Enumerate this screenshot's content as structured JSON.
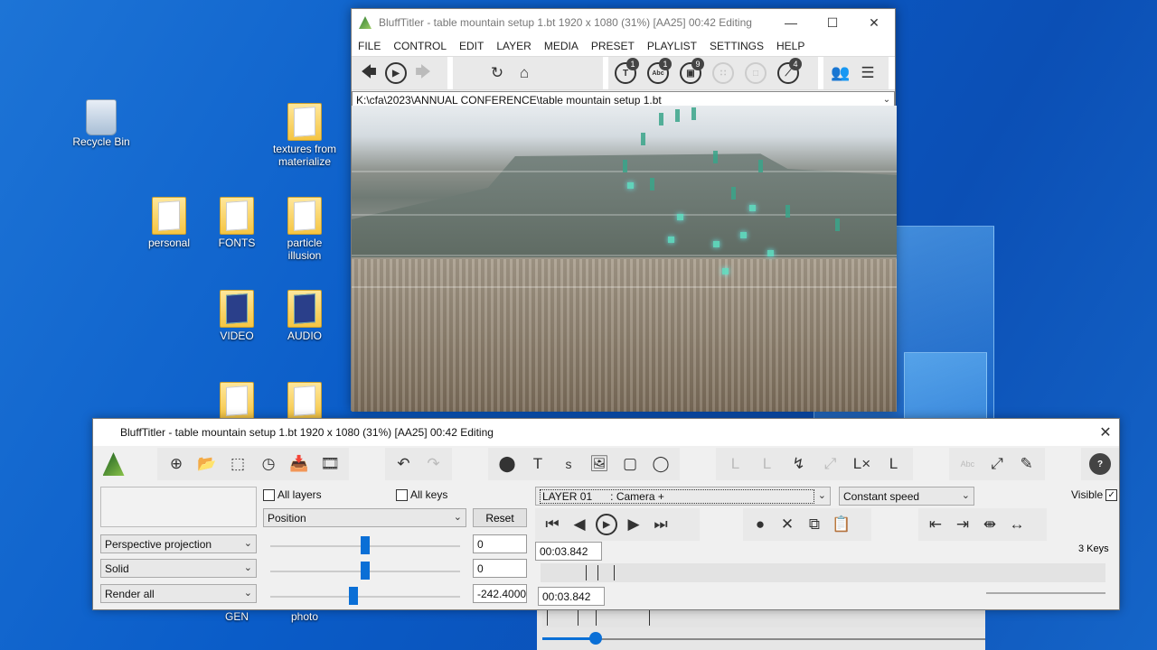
{
  "desktop": {
    "icons": [
      {
        "label": "Recycle Bin",
        "kind": "bin"
      },
      {
        "label": "textures from materialize",
        "kind": "folder"
      },
      {
        "label": "personal",
        "kind": "folder"
      },
      {
        "label": "FONTS",
        "kind": "folder"
      },
      {
        "label": "particle illusion",
        "kind": "folder"
      },
      {
        "label": "VIDEO",
        "kind": "folder-dark"
      },
      {
        "label": "AUDIO",
        "kind": "folder-dark"
      },
      {
        "label": "GEN",
        "kind": "folder"
      },
      {
        "label": "photo",
        "kind": "folder"
      }
    ]
  },
  "main_window": {
    "title": "BluffTitler - table mountain setup 1.bt 1920 x 1080 (31%) [AA25] 00:42 Editing",
    "menu": [
      "FILE",
      "CONTROL",
      "EDIT",
      "LAYER",
      "MEDIA",
      "PRESET",
      "PLAYLIST",
      "SETTINGS",
      "HELP"
    ],
    "toolbar": {
      "badges": {
        "text": "1",
        "abc": "1",
        "image": "9",
        "effect": "4"
      }
    },
    "path": "K:\\cfa\\2023\\ANNUAL CONFERENCE\\table mountain setup 1.bt"
  },
  "layer_panel": {
    "title": "BluffTitler - table mountain setup 1.bt 1920 x 1080 (31%) [AA25] 00:42 Editing",
    "all_layers_label": "All layers",
    "all_keys_label": "All keys",
    "property": "Position",
    "reset_label": "Reset",
    "projection": "Perspective projection",
    "render_mode": "Solid",
    "render_scope": "Render all",
    "values": [
      "0",
      "0",
      "-242.4000"
    ],
    "slider_positions": [
      0.5,
      0.5,
      0.44
    ],
    "layer": "LAYER 01      : Camera +",
    "speed": "Constant speed",
    "visible_label": "Visible",
    "visible_check": "✓",
    "time_top": "00:03.842",
    "time_bottom": "00:03.842",
    "keys_label": "3 Keys",
    "timeline_keys": [
      0.08,
      0.1,
      0.13
    ],
    "lower_keys": [
      0.01,
      0.08,
      0.12,
      0.24
    ],
    "playhead": 0.12
  }
}
